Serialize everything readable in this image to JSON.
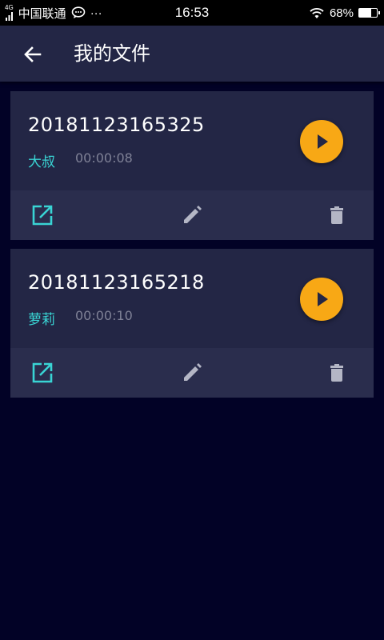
{
  "status_bar": {
    "network_type": "4G",
    "carrier": "中国联通",
    "more": "···",
    "time": "16:53",
    "battery": "68%",
    "battery_level": 0.68
  },
  "header": {
    "back_icon": "arrow-left-icon",
    "title": "我的文件"
  },
  "colors": {
    "background": "#020226",
    "card": "#232645",
    "card_actions": "#2a2d4d",
    "accent_play": "#f8a815",
    "voice_label": "#39d4d4",
    "share_icon": "#39d4d4",
    "muted_icon": "#b4b6c5"
  },
  "files": [
    {
      "name": "20181123165325",
      "voice": "大叔",
      "duration": "00:00:08",
      "icons": [
        "play-icon",
        "share-icon",
        "edit-icon",
        "delete-icon"
      ]
    },
    {
      "name": "20181123165218",
      "voice": "萝莉",
      "duration": "00:00:10",
      "icons": [
        "play-icon",
        "share-icon",
        "edit-icon",
        "delete-icon"
      ]
    }
  ]
}
